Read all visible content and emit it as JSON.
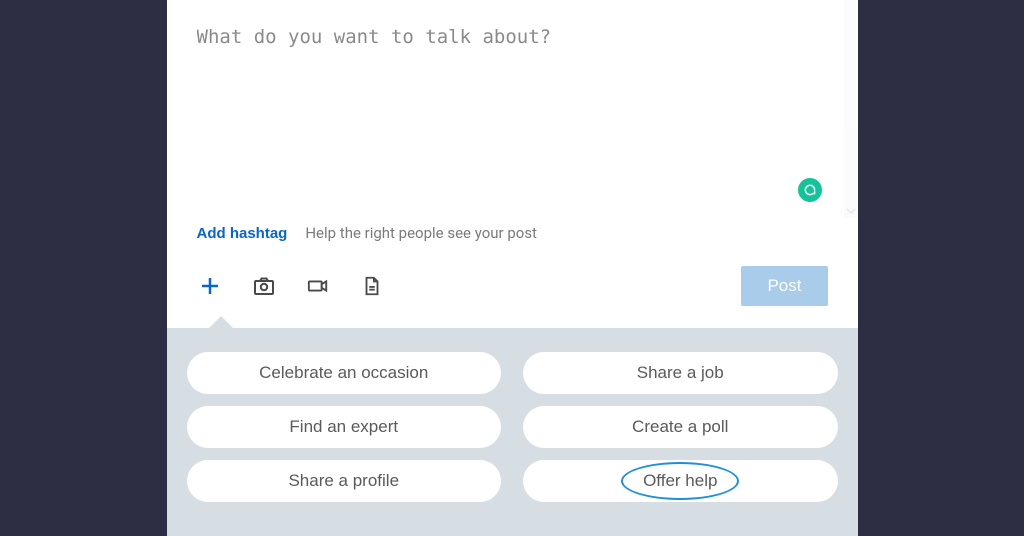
{
  "compose": {
    "placeholder": "What do you want to talk about?",
    "value": ""
  },
  "hashtag": {
    "add_label": "Add hashtag",
    "hint": "Help the right people see your post"
  },
  "toolbar": {
    "plus": "plus-icon",
    "camera": "camera-icon",
    "video": "video-icon",
    "document": "document-icon",
    "post_label": "Post"
  },
  "suggestions": {
    "items": [
      "Celebrate an occasion",
      "Share a job",
      "Find an expert",
      "Create a poll",
      "Share a profile",
      "Offer help"
    ],
    "highlighted_index": 5
  },
  "badges": {
    "grammarly": "grammarly-icon"
  }
}
